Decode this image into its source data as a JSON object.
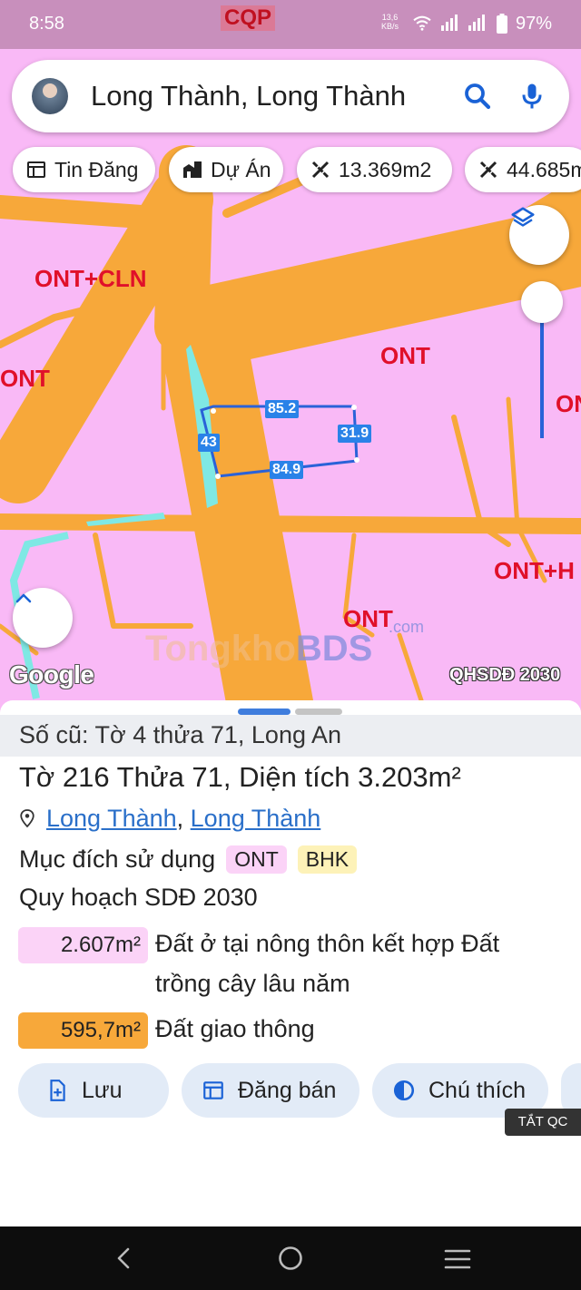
{
  "status_bar": {
    "time": "8:58",
    "carrier_badge": "CQP",
    "speed_value": "13,6",
    "speed_unit": "KB/s",
    "battery": "97%"
  },
  "search": {
    "query": "Long Thành, Long Thành"
  },
  "chips": [
    {
      "label": "Tin Đăng",
      "icon": "listing-icon"
    },
    {
      "label": "Dự Án",
      "icon": "buildings-icon"
    },
    {
      "label": "13.369m2",
      "icon": "measure-icon"
    },
    {
      "label": "44.685m",
      "icon": "measure-icon"
    }
  ],
  "map": {
    "zone_labels": [
      "ONT+CLN",
      "ONT",
      "ONT",
      "ONT",
      "ONT+H",
      "ONT"
    ],
    "dimensions": [
      "85.2",
      "31.9",
      "43",
      "84.9"
    ],
    "google_logo": "Google",
    "plan_badge": "QHSDĐ 2030",
    "watermark_main": "Tongkho",
    "watermark_accent": "BDS",
    "watermark_suffix": ".com",
    "colors": {
      "residential": "#f9b9f6",
      "road": "#f7a83a",
      "water": "#7fe8e4",
      "parcel_outline": "#2a62d8"
    }
  },
  "sheet": {
    "old_parcel": "Số cũ: Tờ 4 thửa 71, Long An",
    "title": "Tờ 216 Thửa 71, Diện tích 3.203m²",
    "location_parts": [
      "Long Thành",
      "Long Thành"
    ],
    "location_separator": ", ",
    "purpose_label": "Mục đích sử dụng",
    "purpose_tags": [
      {
        "label": "ONT",
        "bg": "#fbd3f7"
      },
      {
        "label": "BHK",
        "bg": "#fdf2b8"
      }
    ],
    "plan_label": "Quy hoạch SDĐ 2030",
    "areas": [
      {
        "value": "2.607m²",
        "desc": "Đất ở tại nông thôn kết hợp Đất trồng cây lâu năm",
        "bg": "#fbd3f7"
      },
      {
        "value": "595,7m²",
        "desc": "Đất giao thông",
        "bg": "#f7a83a"
      }
    ],
    "actions": [
      {
        "label": "Lưu",
        "icon": "save-doc-icon"
      },
      {
        "label": "Đăng bán",
        "icon": "post-sale-icon"
      },
      {
        "label": "Chú thích",
        "icon": "legend-icon"
      }
    ],
    "ad_toggle": "TẮT QC"
  }
}
